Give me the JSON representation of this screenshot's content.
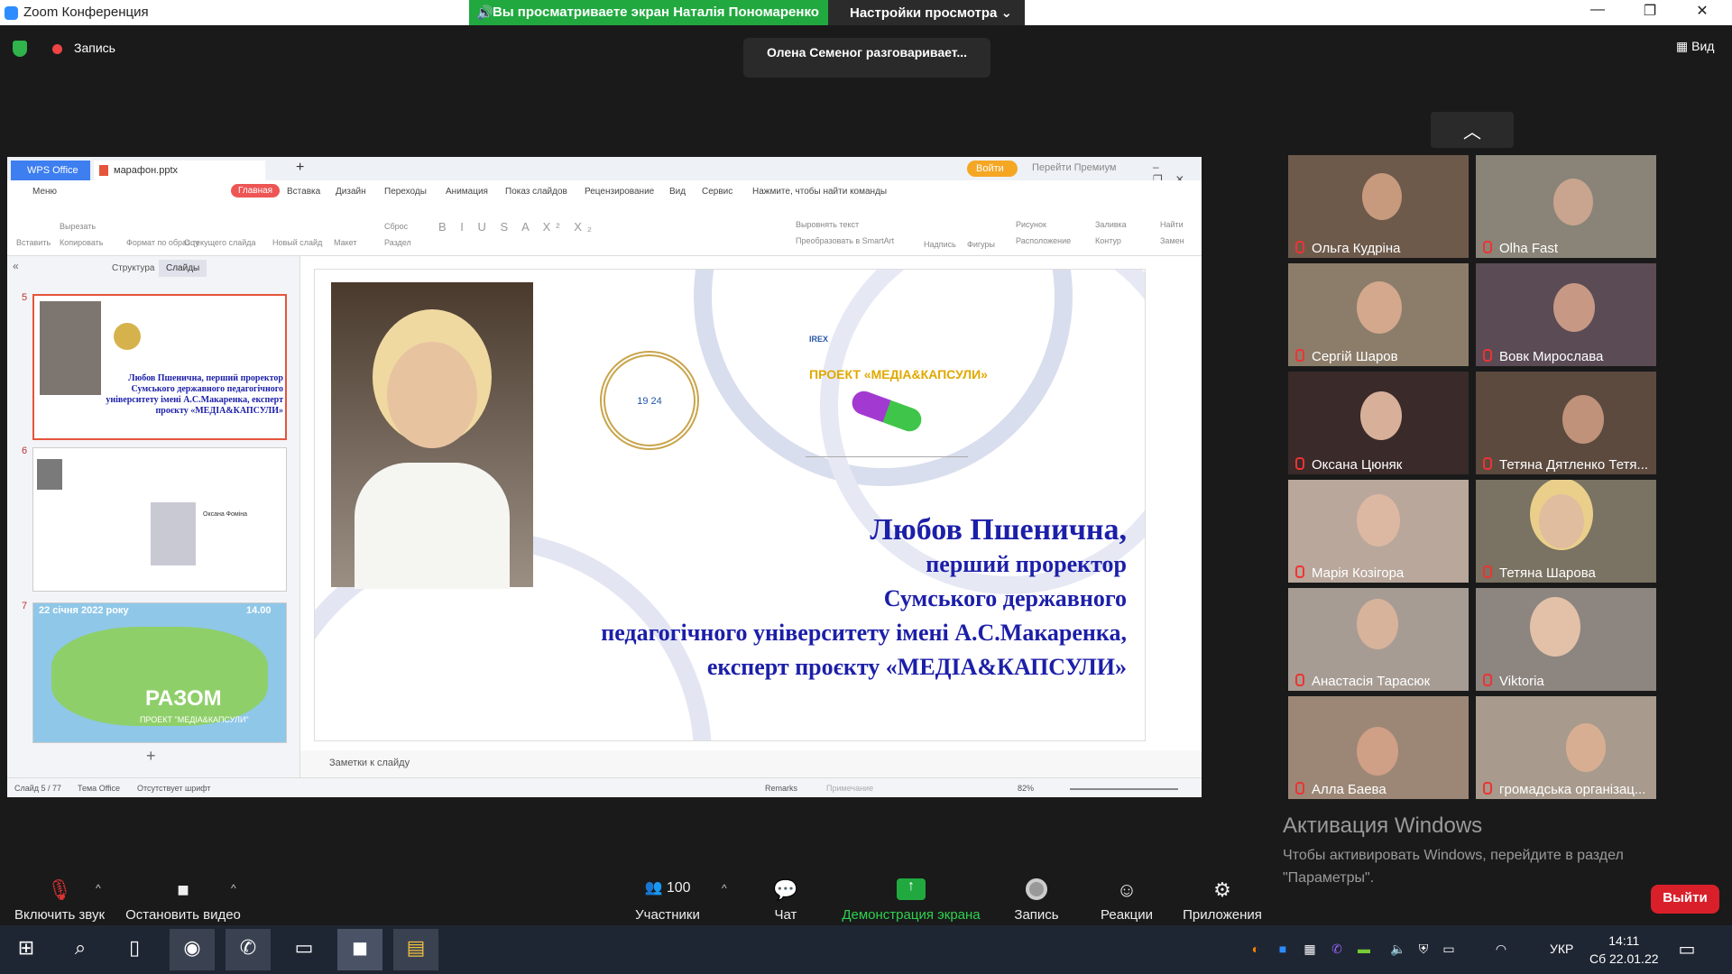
{
  "titlebar": {
    "title": "Zoom Конференция",
    "share_banner": "Вы просматриваете экран Наталія Пономаренко",
    "view_settings": "Настройки просмотра ⌄"
  },
  "topbar": {
    "record": "Запись",
    "speaker": "Олена Семеног разговаривает...",
    "view": "Вид"
  },
  "wps": {
    "tab_office": "WPS Office",
    "tab_file": "марафон.pptx",
    "login": "Войти",
    "premium": "Перейти Премиум",
    "menu": [
      "Меню",
      "Главная",
      "Вставка",
      "Дизайн",
      "Переходы",
      "Анимация",
      "Показ слайдов",
      "Рецензирование",
      "Вид",
      "Сервис",
      "Нажмите, чтобы найти команды"
    ],
    "ribbon": [
      "Вставить",
      "Вырезать",
      "Копировать",
      "Формат по образцу",
      "С текущего слайда",
      "Новый слайд",
      "Макет",
      "Сброс",
      "Раздел",
      "Выровнять текст",
      "Преобразовать в SmartArt",
      "Надпись",
      "Фигуры",
      "Рисунок",
      "Расположение",
      "Заливка",
      "Контур",
      "Найти",
      "Замен"
    ],
    "panel_tabs": [
      "Структура",
      "Слайды"
    ],
    "thumbs": [
      {
        "num": "5",
        "text": "Любов Пшенична, перший проректор Сумського державного педагогічного університету імені А.С.Макаренка, експерт проєкту «МЕДІА&КАПСУЛИ»"
      },
      {
        "num": "6",
        "text": "Оксана Фоміна"
      },
      {
        "num": "7",
        "date": "22 січня 2022 року",
        "time": "14.00",
        "big": "РАЗОМ",
        "sub": "ПРОЕКТ \"МЕДІА&КАПСУЛИ\""
      }
    ],
    "slide": {
      "line1": "Любов Пшенична,",
      "line2": "перший проректор",
      "line3": "Сумського державного",
      "line4": "педагогічного університету імені А.С.Макаренка,",
      "line5": "експерт проєкту «МЕДІА&КАПСУЛИ»",
      "project": "ПРОЕКТ «МЕДІА&КАПСУЛИ»",
      "irex": "IREX",
      "emblem_year": "19 24"
    },
    "notes": "Заметки к слайду",
    "status": {
      "slide": "Слайд 5 / 77",
      "theme": "Тема Office",
      "font": "Отсутствует шрифт",
      "remarks": "Remarks",
      "comment": "Примечание",
      "zoom": "82%"
    }
  },
  "participants": [
    {
      "name": "Ольга Кудріна",
      "bg": "#6e5a4b"
    },
    {
      "name": "Olha Fast",
      "bg": "#8a8478"
    },
    {
      "name": "Сергій Шаров",
      "bg": "#8c7d6a"
    },
    {
      "name": "Вовк Мирослава",
      "bg": "#5a4b55"
    },
    {
      "name": "Оксана Цюняк",
      "bg": "#3a2a2a"
    },
    {
      "name": "Тетяна Дятленко Тетя...",
      "bg": "#5c4a3f"
    },
    {
      "name": "Марія Козігора",
      "bg": "#b9a79c"
    },
    {
      "name": "Тетяна Шарова",
      "bg": "#7a7262"
    },
    {
      "name": "Анастасія Тарасюк",
      "bg": "#a79c93"
    },
    {
      "name": "Viktoria",
      "bg": "#8d8580"
    },
    {
      "name": "Алла Баева",
      "bg": "#9c8776"
    },
    {
      "name": "громадська організац...",
      "bg": "#a89a8c"
    }
  ],
  "watermark": {
    "title": "Активация Windows",
    "line1": "Чтобы активировать Windows, перейдите в раздел",
    "line2": "\"Параметры\"."
  },
  "controls": {
    "mute": "Включить звук",
    "video": "Остановить видео",
    "participants": "Участники",
    "count": "100",
    "chat": "Чат",
    "share": "Демонстрация экрана",
    "record": "Запись",
    "reactions": "Реакции",
    "apps": "Приложения",
    "leave": "Выйти"
  },
  "taskbar": {
    "lang": "УКР",
    "time": "14:11",
    "date": "Сб 22.01.22"
  },
  "colors": {
    "share_green": "#21a940",
    "leave_red": "#d9202a",
    "slide_blue": "#1c1fa8",
    "wps_blue": "#3d7ef0"
  }
}
